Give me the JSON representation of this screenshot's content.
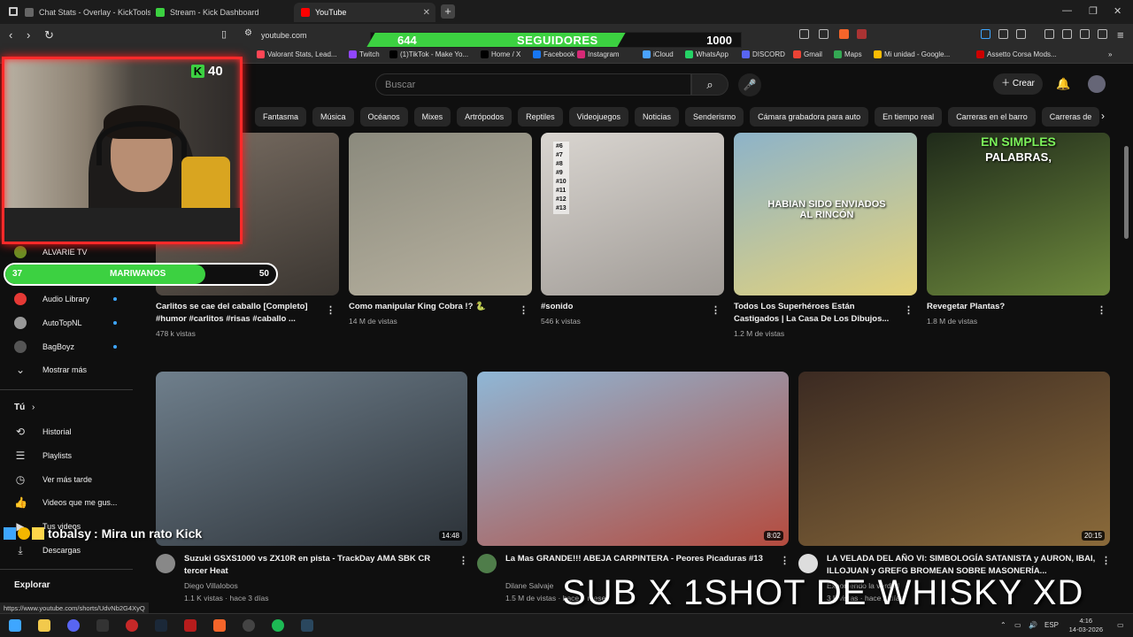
{
  "tabs": [
    {
      "label": "Chat Stats - Overlay - KickTools",
      "color": "#666666"
    },
    {
      "label": "Stream - Kick Dashboard",
      "color": "#3cd141"
    },
    {
      "label": "YouTube",
      "color": "#ff0000"
    }
  ],
  "new_tab": "+",
  "address": {
    "url": "youtube.com"
  },
  "followers": {
    "current": "644",
    "label": "SEGUIDORES",
    "goal": "1000",
    "progress": 0.644
  },
  "bookmarks": [
    {
      "label": "Valorant Stats, Lead...",
      "color": "#ff4655"
    },
    {
      "label": "Twitch",
      "color": "#9146ff"
    },
    {
      "label": "(1)TikTok - Make Yo...",
      "color": "#000000"
    },
    {
      "label": "Home / X",
      "color": "#000000"
    },
    {
      "label": "Facebook",
      "color": "#1877f2"
    },
    {
      "label": "Instagram",
      "color": "#d62976"
    },
    {
      "label": "iCloud",
      "color": "#4aa3ff"
    },
    {
      "label": "WhatsApp",
      "color": "#25d366"
    },
    {
      "label": "DISCORD",
      "color": "#5865f2"
    },
    {
      "label": "Gmail",
      "color": "#ea4335"
    },
    {
      "label": "Maps",
      "color": "#34a853"
    },
    {
      "label": "Mi unidad - Google...",
      "color": "#fbbc04"
    },
    {
      "label": "Assetto Corsa Mods...",
      "color": "#cc0000"
    }
  ],
  "yt": {
    "search_placeholder": "Buscar",
    "create_label": "Crear",
    "chips": [
      "Fantasma",
      "Música",
      "Océanos",
      "Mixes",
      "Artrópodos",
      "Reptiles",
      "Videojuegos",
      "Noticias",
      "Senderismo",
      "Cámara grabadora para auto",
      "En tiempo real",
      "Carreras en el barro",
      "Carreras de"
    ]
  },
  "overlay": {
    "kick_count": "40",
    "bar": {
      "left": "37",
      "label": "MARIWANOS",
      "right": "50",
      "progress": 0.74
    },
    "chat_user": "tobalsy",
    "chat_msg": ": Mira un rato Kick",
    "big_text": "SUB X 1SHOT DE WHISKY XD"
  },
  "sidebar": {
    "subs": [
      {
        "label": "ALVARIE TV",
        "color": "#6b8e23"
      },
      {
        "label": "Audio Library",
        "color": "#e53935"
      },
      {
        "label": "AutoTopNL",
        "color": "#999999"
      },
      {
        "label": "BagBoyz",
        "color": "#555555"
      }
    ],
    "show_more": "Mostrar más",
    "you_label": "Tú",
    "you_items": [
      "Historial",
      "Playlists",
      "Ver más tarde",
      "Videos que me gus...",
      "Tus videos",
      "Descargas"
    ],
    "explore_label": "Explorar"
  },
  "shorts_row": [
    {
      "title": "Carlitos se cae del caballo [Completo] #humor #carlitos #risas #caballo ...",
      "views": "478 k vistas",
      "colors": [
        "#7a6e63",
        "#3b3631"
      ]
    },
    {
      "title": "Como manipular King Cobra !? 🐍",
      "views": "14 M de vistas",
      "colors": [
        "#8b8a7d",
        "#b8b2a0"
      ]
    },
    {
      "title": "#sonido",
      "views": "546 k vistas",
      "colors": [
        "#d9d5d0",
        "#9f9a95"
      ],
      "list": [
        "#6",
        "#7",
        "#8",
        "#9",
        "#10",
        "#11",
        "#12",
        "#13"
      ]
    },
    {
      "title": "Todos Los Superhéroes Están Castigados | La Casa De Los Dibujos...",
      "views": "1.2 M de vistas",
      "colors": [
        "#8db3c9",
        "#e5d37a"
      ],
      "caption": "HABIAN SIDO ENVIADOS AL RINCÓN"
    },
    {
      "title": "Revegetar Plantas?",
      "views": "1.8 M de vistas",
      "colors": [
        "#1f2a1a",
        "#6e8a3d"
      ],
      "caption1": "EN SIMPLES",
      "caption2": "PALABRAS,"
    }
  ],
  "videos": [
    {
      "title": "Suzuki GSXS1000 vs ZX10R en pista - TrackDay AMA SBK CR tercer Heat",
      "channel": "Diego Villalobos",
      "meta": "1.1 K vistas · hace 3 días",
      "duration": "14:48",
      "colors": [
        "#6f7f8c",
        "#2c3238"
      ],
      "chan_color": "#888888"
    },
    {
      "title": "La Mas GRANDE!!! ABEJA CARPINTERA - Peores Picaduras #13",
      "channel": "Dilane Salvaje",
      "meta": "1.5 M de vistas · hace 6 meses",
      "duration": "8:02",
      "colors": [
        "#8fb7d6",
        "#b44b3e"
      ],
      "chan_color": "#4f7d4a"
    },
    {
      "title": "LA VELADA DEL AÑO VI: SIMBOLOGÍA SATANISTA y AURON, IBAI, ILLOJUAN y GREFG BROMEAN SOBRE MASONERÍA...",
      "channel": "Exponiendo la verdad",
      "meta": "3 k vistas · hace 2 días",
      "duration": "20:15",
      "colors": [
        "#3b2a22",
        "#8a6a3a"
      ],
      "chan_color": "#dddddd"
    }
  ],
  "status_url": "https://www.youtube.com/shorts/UdvNb2G4XyQ",
  "taskbar": {
    "time": "4:16",
    "date": "14-03-2026",
    "lang": "ESP"
  }
}
